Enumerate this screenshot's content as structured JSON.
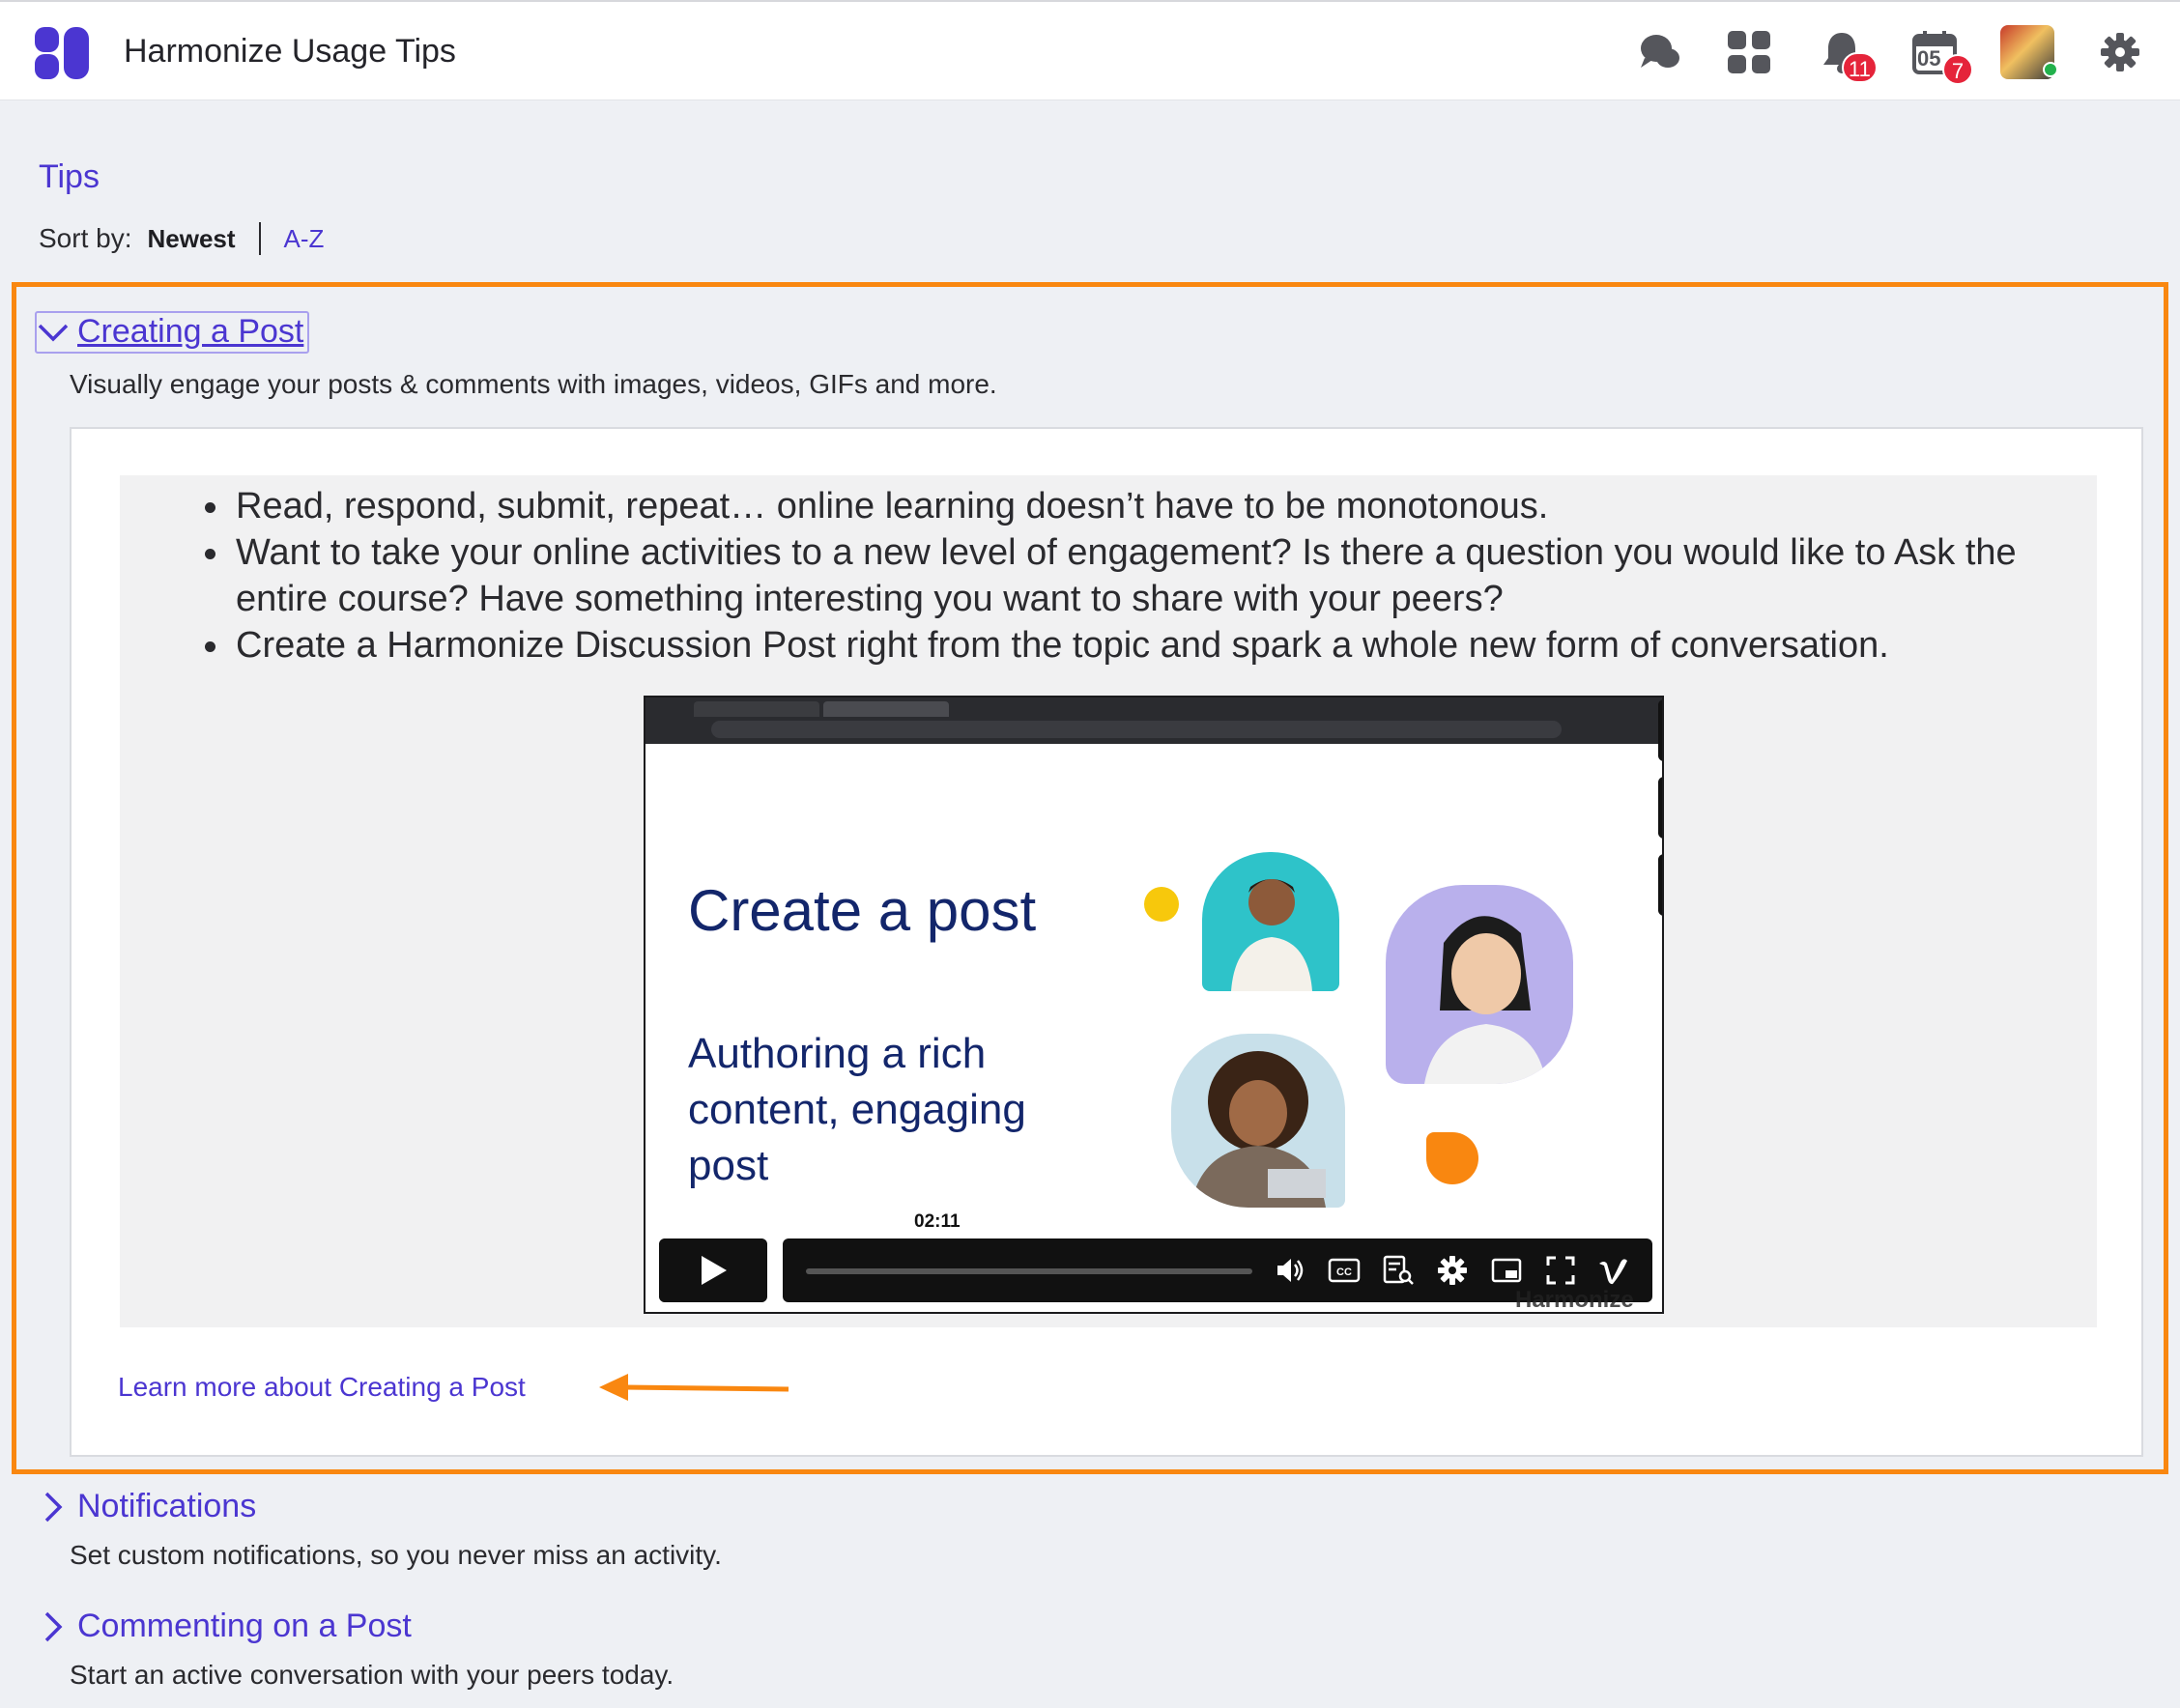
{
  "header": {
    "app_title": "Harmonize Usage Tips",
    "notifications_badge": "11",
    "calendar_date": "05",
    "calendar_badge": "7"
  },
  "tips": {
    "title": "Tips",
    "sort_label": "Sort by:",
    "sort_newest": "Newest",
    "sort_az": "A-Z"
  },
  "sections": [
    {
      "title": "Creating a Post",
      "description": "Visually engage your posts & comments with images, videos, GIFs and more.",
      "expanded": true,
      "bullets": [
        "Read, respond, submit, repeat… online learning doesn’t have to be monotonous.",
        "Want to take your online activities to a new level of engagement? Is there a question you would like to Ask the entire course? Have something interesting you want to share with your peers?",
        "Create a Harmonize Discussion Post right from the topic and spark a whole new form of conversation."
      ],
      "video": {
        "slide_title": "Create a post",
        "slide_subtitle": "Authoring a rich content, engaging post",
        "time": "02:11",
        "watermark": "Harmonize"
      },
      "learn_more": "Learn more about Creating a Post"
    },
    {
      "title": "Notifications",
      "description": "Set custom notifications, so you never miss an activity.",
      "expanded": false
    },
    {
      "title": "Commenting on a Post",
      "description": "Start an active conversation with your peers today.",
      "expanded": false
    }
  ],
  "colors": {
    "accent": "#4b36d1",
    "highlight": "#f98710",
    "badge": "#e5243a",
    "slide_text": "#13266b"
  }
}
